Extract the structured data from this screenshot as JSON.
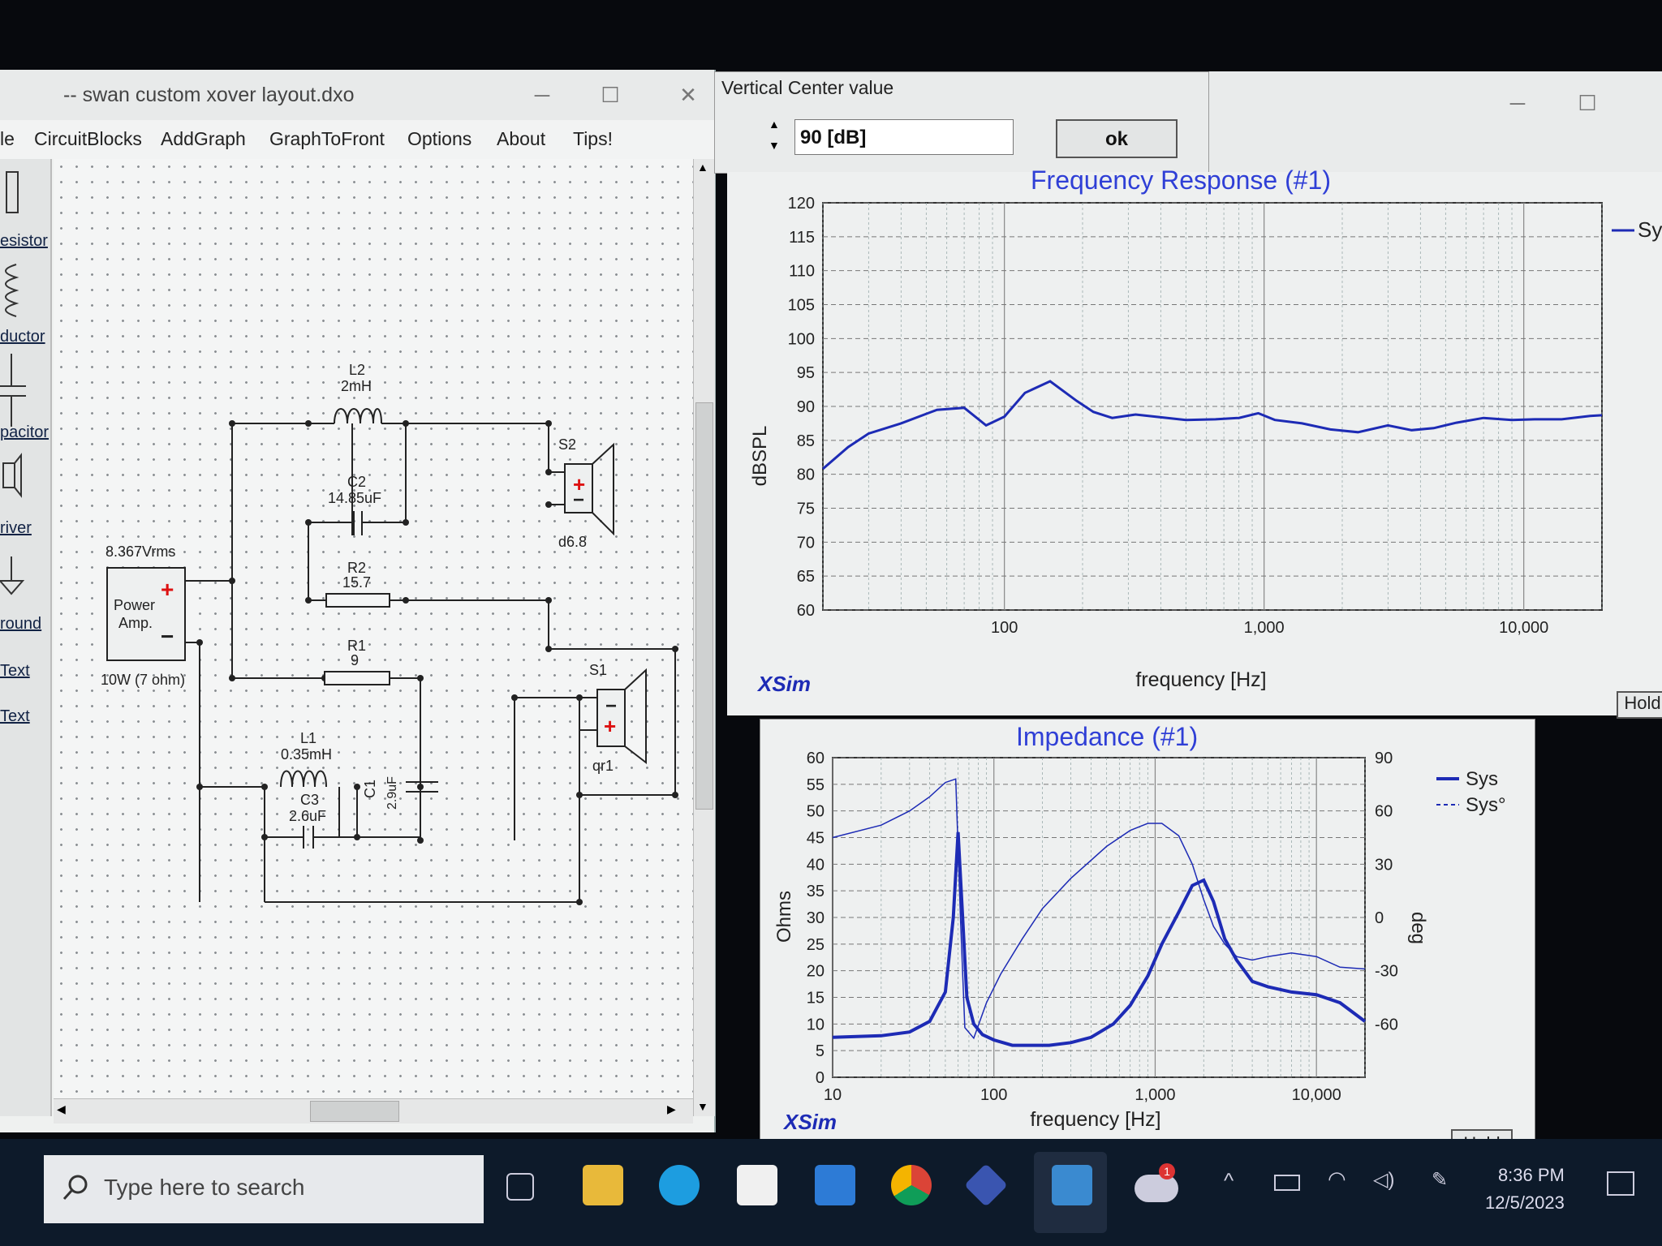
{
  "schematic": {
    "title": "-- swan custom xover layout.dxo",
    "menu": [
      "le",
      "CircuitBlocks",
      "AddGraph",
      "GraphToFront",
      "Options",
      "About",
      "Tips!"
    ],
    "palette": [
      "esistor",
      "ductor",
      "pacitor",
      "river",
      "round",
      "Text",
      "Text"
    ],
    "labels": {
      "l2": "L2",
      "l2v": "2mH",
      "c2": "C2",
      "c2v": "14.85uF",
      "r2": "R2",
      "r2v": "15.7",
      "r1": "R1",
      "r1v": "9",
      "l1": "L1",
      "l1v": "0.35mH",
      "c3": "C3",
      "c3v": "2.6uF",
      "c1": "C1",
      "c1v": "2.9uF",
      "s2": "S2",
      "s2v": "d6.8",
      "s1": "S1",
      "s1v": "qr1",
      "amp_vrms": "8.367Vrms",
      "amp1": "Power",
      "amp2": "Amp.",
      "amp_rating": "10W (7 ohm)"
    }
  },
  "dialog": {
    "title": "Vertical Center value",
    "value": "90 [dB]",
    "ok": "ok"
  },
  "freq_graph": {
    "title": "Frequency Response (#1)",
    "ylabel": "dBSPL",
    "xlabel": "frequency [Hz]",
    "brand": "XSim",
    "legend": "Sy",
    "hold": "Hold",
    "yticks": [
      "120",
      "115",
      "110",
      "105",
      "100",
      "95",
      "90",
      "85",
      "80",
      "75",
      "70",
      "65",
      "60"
    ],
    "xticks": [
      "100",
      "1,000",
      "10,000"
    ],
    "line_color": "#1d2bb5"
  },
  "imp_graph": {
    "title": "Impedance (#1)",
    "ylabel": "Ohms",
    "y2label": "deg",
    "xlabel": "frequency [Hz]",
    "brand": "XSim",
    "hold": "Hold",
    "legend": [
      "Sys",
      "Sys°"
    ],
    "yticks": [
      "60",
      "55",
      "50",
      "45",
      "40",
      "35",
      "30",
      "25",
      "20",
      "15",
      "10",
      "5",
      "0"
    ],
    "y2ticks": [
      "90",
      "60",
      "30",
      "0",
      "-30",
      "-60"
    ],
    "xticks": [
      "10",
      "100",
      "1,000",
      "10,000"
    ]
  },
  "chart_data": [
    {
      "type": "line",
      "title": "Frequency Response (#1)",
      "xlabel": "frequency [Hz]",
      "ylabel": "dBSPL",
      "xscale": "log",
      "xlim": [
        20,
        20000
      ],
      "ylim": [
        60,
        120
      ],
      "grid": true,
      "legend": "top-right",
      "series": [
        {
          "name": "Sy",
          "x": [
            20,
            25,
            30,
            40,
            55,
            70,
            85,
            100,
            120,
            150,
            190,
            220,
            260,
            320,
            400,
            500,
            650,
            800,
            950,
            1100,
            1400,
            1800,
            2300,
            3000,
            3700,
            4500,
            5500,
            7000,
            9000,
            11000,
            14000,
            18000,
            20000
          ],
          "y": [
            80.8,
            84,
            86,
            87.5,
            89.5,
            89.8,
            87.2,
            88.5,
            92,
            93.7,
            90.8,
            89.2,
            88.3,
            88.8,
            88.4,
            88.0,
            88.1,
            88.3,
            89.0,
            88.0,
            87.5,
            86.6,
            86.2,
            87.2,
            86.5,
            86.8,
            87.6,
            88.3,
            88.0,
            88.1,
            88.1,
            88.6,
            88.7
          ]
        }
      ]
    },
    {
      "type": "line",
      "title": "Impedance (#1)",
      "xlabel": "frequency [Hz]",
      "ylabel": "Ohms",
      "y2label": "deg",
      "xscale": "log",
      "xlim": [
        10,
        20000
      ],
      "ylim": [
        0,
        60
      ],
      "y2lim": [
        -90,
        90
      ],
      "grid": true,
      "legend": "right",
      "series": [
        {
          "name": "Sys",
          "axis": "left",
          "x": [
            10,
            20,
            30,
            40,
            50,
            56,
            60,
            64,
            68,
            75,
            85,
            100,
            130,
            170,
            220,
            300,
            400,
            550,
            700,
            900,
            1100,
            1400,
            1700,
            2000,
            2300,
            2700,
            3200,
            4000,
            5000,
            7000,
            10000,
            14000,
            20000
          ],
          "y": [
            7.5,
            7.8,
            8.5,
            10.5,
            16,
            30,
            46,
            30,
            15,
            10,
            8,
            7,
            6,
            6,
            6,
            6.5,
            7.5,
            10,
            13.5,
            19,
            25,
            31,
            36,
            37,
            33,
            26,
            22,
            18,
            17,
            16,
            15.5,
            14,
            10.5
          ]
        },
        {
          "name": "Sys°",
          "axis": "right",
          "x": [
            10,
            20,
            30,
            40,
            50,
            58,
            62,
            66,
            75,
            90,
            110,
            150,
            200,
            300,
            500,
            700,
            900,
            1100,
            1400,
            1700,
            2000,
            2300,
            2700,
            3200,
            4000,
            5000,
            7000,
            10000,
            14000,
            20000
          ],
          "y": [
            45,
            52,
            60,
            68,
            76,
            78,
            0,
            -62,
            -68,
            -48,
            -32,
            -12,
            5,
            22,
            40,
            49,
            53,
            53,
            46,
            30,
            10,
            -5,
            -15,
            -22,
            -24,
            -22,
            -20,
            -22,
            -28,
            -29
          ]
        }
      ]
    }
  ],
  "taskbar": {
    "search_placeholder": "Type here to search",
    "time": "8:36 PM",
    "date": "12/5/2023",
    "badge": "1"
  }
}
